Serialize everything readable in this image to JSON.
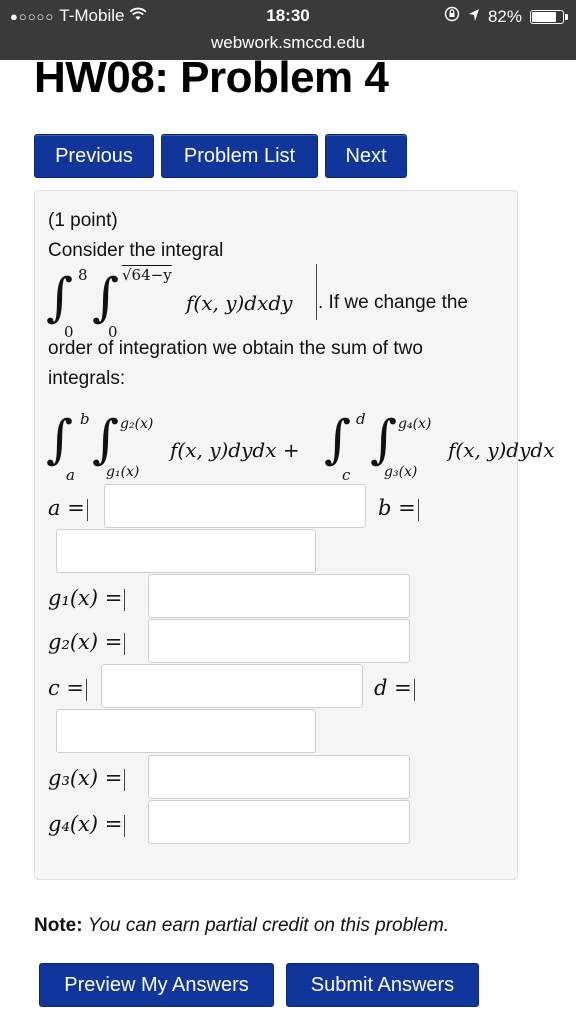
{
  "status": {
    "signal_dots": "●○○○○",
    "carrier": "T-Mobile",
    "time": "18:30",
    "battery": "82%",
    "battery_level": 0.82,
    "url": "webwork.smccd.edu"
  },
  "page": {
    "title": "HW08: Problem 4"
  },
  "nav": {
    "previous": "Previous",
    "problem_list": "Problem List",
    "next": "Next"
  },
  "problem": {
    "points": "(1 point)",
    "intro": "Consider the integral",
    "integral1": {
      "upper_outer": "8",
      "lower_outer": "0",
      "upper_inner": "√64−y",
      "lower_inner": "0",
      "integrand": "f(x, y)dxdy"
    },
    "after_integral": ". If we change the",
    "line2": "order of integration we obtain the sum of two",
    "line3": "integrals:",
    "integral2": {
      "outer1_upper": "b",
      "outer1_lower": "a",
      "inner1_upper": "g₂(x)",
      "inner1_lower": "g₁(x)",
      "integrand1": "f(x, y)dydx +",
      "outer2_upper": "d",
      "outer2_lower": "c",
      "inner2_upper": "g₄(x)",
      "inner2_lower": "g₃(x)",
      "integrand2": "f(x, y)dydx"
    },
    "labels": {
      "a": "a =",
      "b": "b =",
      "g1": "g₁(x) =",
      "g2": "g₂(x) =",
      "c": "c =",
      "d": "d =",
      "g3": "g₃(x) =",
      "g4": "g₄(x) ="
    }
  },
  "note": {
    "bold": "Note:",
    "text": "You can earn partial credit on this problem."
  },
  "actions": {
    "preview": "Preview My Answers",
    "submit": "Submit Answers"
  }
}
